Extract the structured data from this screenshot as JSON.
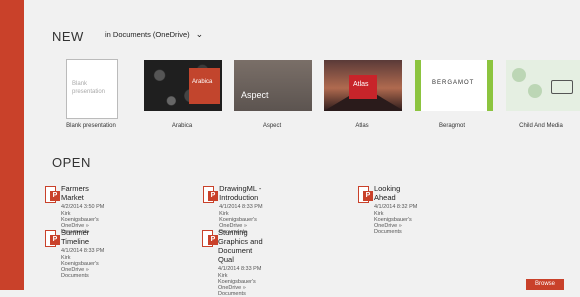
{
  "new_section": {
    "title": "NEW",
    "location": "in Documents (OneDrive)"
  },
  "templates": [
    {
      "name": "Blank presentation",
      "thumb_text": "Blank presentation"
    },
    {
      "name": "Arabica",
      "thumb_text": "Arabica"
    },
    {
      "name": "Aspect",
      "thumb_text": "Aspect"
    },
    {
      "name": "Atlas",
      "thumb_text": "Atlas"
    },
    {
      "name": "Beragmot",
      "thumb_text": "BERGAMOT"
    },
    {
      "name": "Child And Media"
    }
  ],
  "open_section": {
    "title": "OPEN"
  },
  "recent_files": [
    {
      "name": "Farmers Market",
      "date": "4/2/2014 3:50 PM",
      "path": "Kirk Koenigsbauer's OneDrive » Documents"
    },
    {
      "name": "DrawingML - Introduction",
      "date": "4/1/2014 8:33 PM",
      "path": "Kirk Koenigsbauer's OneDrive » Documents"
    },
    {
      "name": "Looking Ahead",
      "date": "4/1/2014 8:32 PM",
      "path": "Kirk Koenigsbauer's OneDrive » Documents"
    },
    {
      "name": "Summer Timeline",
      "date": "4/1/2014 8:33 PM",
      "path": "Kirk Koenigsbauer's OneDrive » Documents"
    },
    {
      "name": "Stunning Graphics and Document Qual",
      "date": "4/1/2014 8:33 PM",
      "path": "Kirk Koenigsbauer's OneDrive » Documents"
    }
  ],
  "browse_label": "Browse",
  "colors": {
    "accent": "#c9412a",
    "background": "#f1f1f1"
  }
}
